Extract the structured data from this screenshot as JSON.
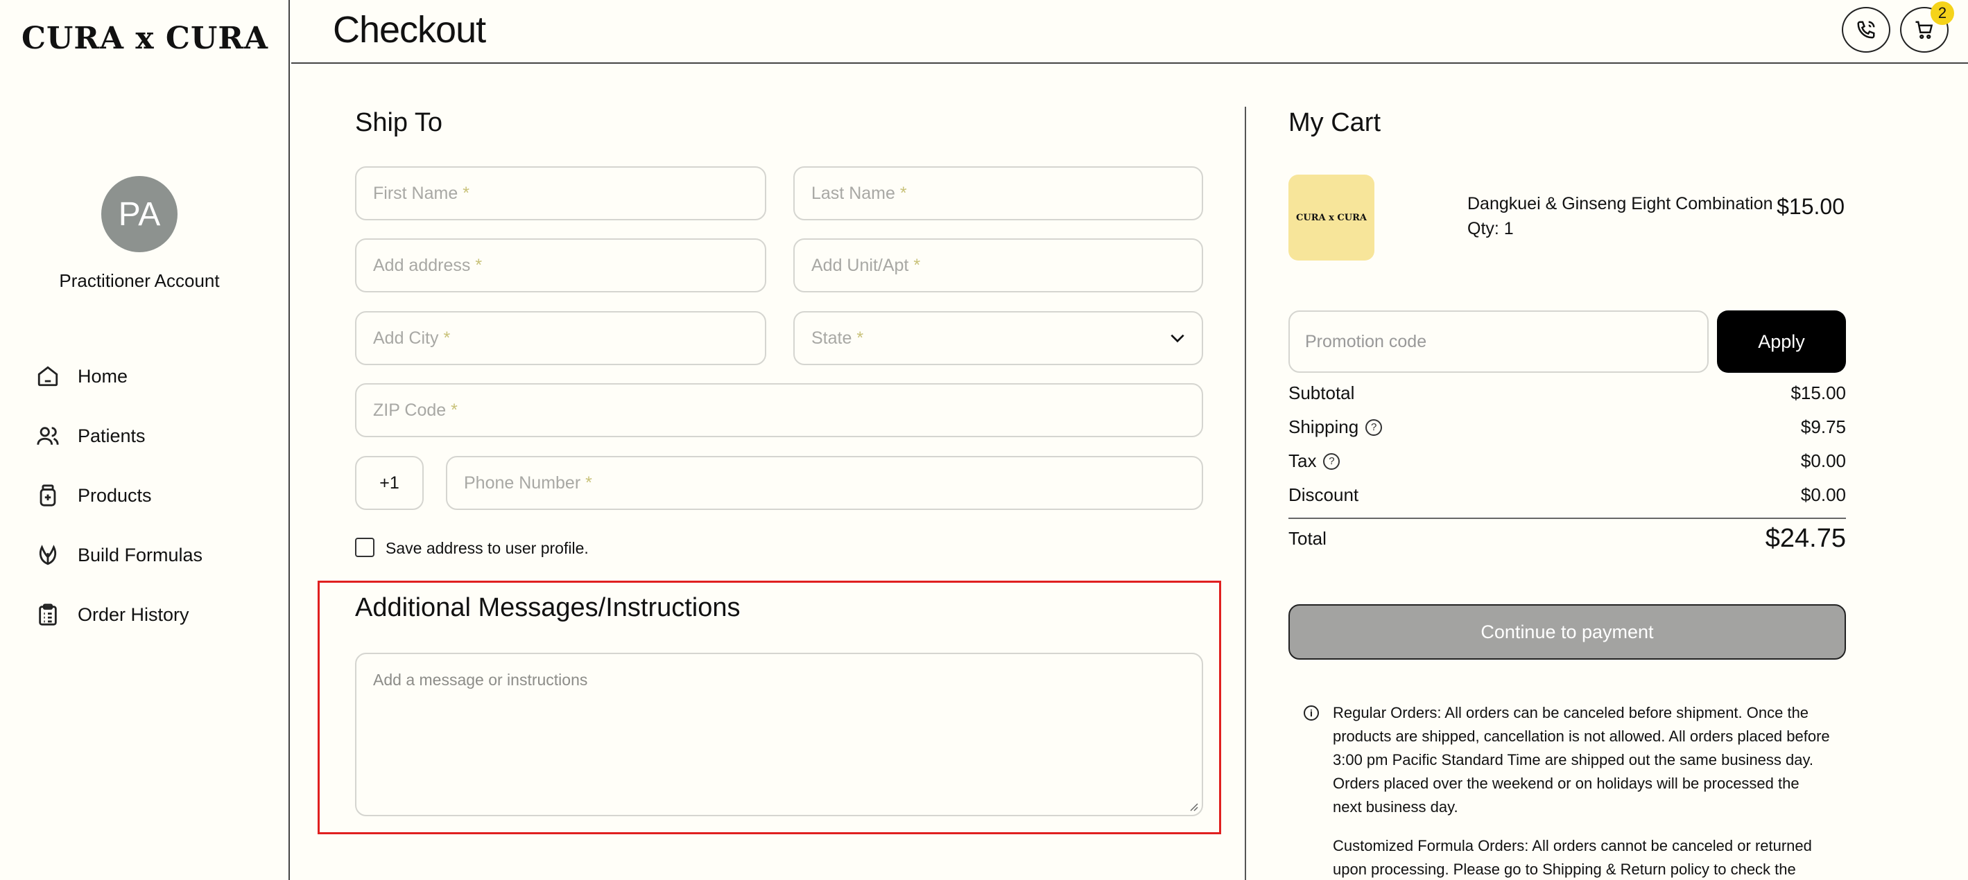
{
  "brand": {
    "logo": "CURA x CURA",
    "thumb_logo": "CURA x CURA"
  },
  "account": {
    "initials": "PA",
    "name": "Practitioner Account"
  },
  "nav": [
    {
      "label": "Home",
      "icon": "home-icon"
    },
    {
      "label": "Patients",
      "icon": "users-icon"
    },
    {
      "label": "Products",
      "icon": "product-bottle-icon"
    },
    {
      "label": "Build Formulas",
      "icon": "leaf-icon"
    },
    {
      "label": "Order History",
      "icon": "clipboard-icon"
    }
  ],
  "header": {
    "title": "Checkout",
    "cart_count": "2"
  },
  "ship_to": {
    "title": "Ship To",
    "first_name": "First Name",
    "last_name": "Last Name",
    "address": "Add address",
    "unit": "Add Unit/Apt",
    "city": "Add City",
    "state": "State",
    "zip": "ZIP Code",
    "country_code": "+1",
    "phone": "Phone Number",
    "required_mark": "*",
    "save_label": "Save address to user profile."
  },
  "messages": {
    "title": "Additional Messages/Instructions",
    "placeholder": "Add a message or instructions"
  },
  "cart": {
    "title": "My Cart",
    "item": {
      "name": "Dangkuei & Ginseng Eight Combination",
      "qty": "Qty: 1",
      "price": "$15.00"
    },
    "promo_placeholder": "Promotion code",
    "apply_label": "Apply",
    "summary": {
      "subtotal_label": "Subtotal",
      "subtotal": "$15.00",
      "shipping_label": "Shipping",
      "shipping": "$9.75",
      "tax_label": "Tax",
      "tax": "$0.00",
      "discount_label": "Discount",
      "discount": "$0.00",
      "total_label": "Total",
      "total": "$24.75"
    },
    "continue_label": "Continue to payment",
    "notice_regular": "Regular Orders: All orders can be canceled before shipment. Once the products are shipped, cancellation is not allowed. All orders placed before 3:00 pm Pacific Standard Time are shipped out the same business day. Orders placed over the weekend or on holidays will be processed the next business day.",
    "notice_custom": "Customized Formula Orders: All orders cannot be canceled or returned upon processing. Please go to Shipping & Return policy to check the"
  },
  "colors": {
    "highlight": "#e02020",
    "badge": "#f5d31a",
    "avatar": "#8d928f",
    "thumb": "#f7e59a"
  }
}
